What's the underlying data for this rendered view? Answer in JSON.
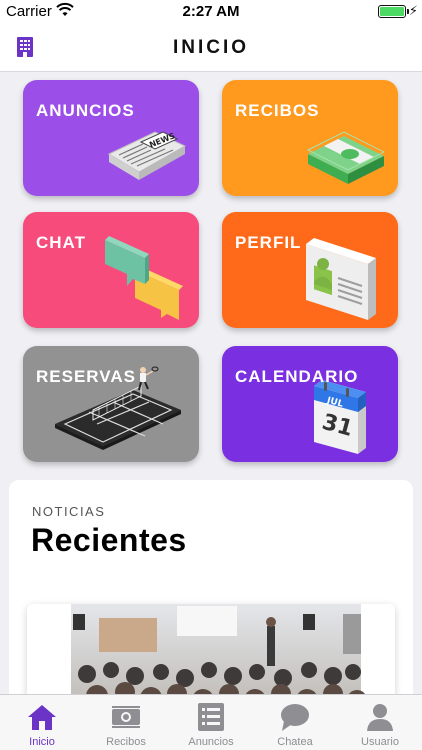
{
  "status_bar": {
    "carrier": "Carrier",
    "time": "2:27 AM"
  },
  "navbar": {
    "title": "INICIO",
    "left_icon": "building-icon"
  },
  "tiles": [
    {
      "label": "ANUNCIOS",
      "color": "#9b4fe8",
      "icon": "newspaper-icon"
    },
    {
      "label": "RECIBOS",
      "color": "#ff9a1f",
      "icon": "money-icon"
    },
    {
      "label": "CHAT",
      "color": "#f74b7c",
      "icon": "chat-bubbles-icon"
    },
    {
      "label": "PERFIL",
      "color": "#ff6a1a",
      "icon": "id-card-icon"
    },
    {
      "label": "RESERVAS",
      "color": "#929292",
      "icon": "tennis-court-icon"
    },
    {
      "label": "CALENDARIO",
      "color": "#7a2fe0",
      "icon": "calendar-icon",
      "calendar_month": "JUL",
      "calendar_day": "31"
    }
  ],
  "news": {
    "kicker": "NOTICIAS",
    "heading": "Recientes"
  },
  "tabbar": {
    "items": [
      {
        "label": "Inicio",
        "icon": "house-icon",
        "active": true
      },
      {
        "label": "Recibos",
        "icon": "money-icon",
        "active": false
      },
      {
        "label": "Anuncios",
        "icon": "list-icon",
        "active": false
      },
      {
        "label": "Chatea",
        "icon": "chat-icon",
        "active": false
      },
      {
        "label": "Usuario",
        "icon": "user-icon",
        "active": false
      }
    ],
    "active_color": "#6b34c6",
    "inactive_color": "#8e8e93"
  }
}
